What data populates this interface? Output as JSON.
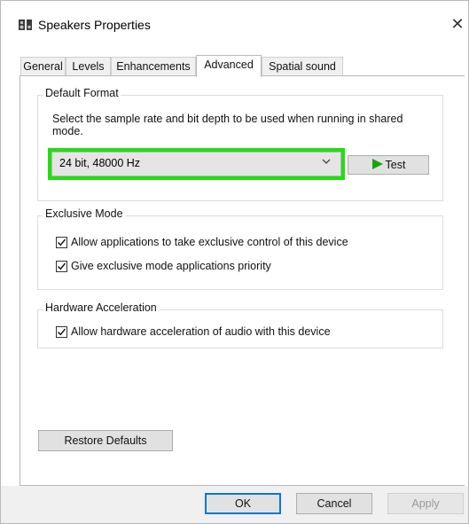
{
  "window": {
    "title": "Speakers Properties",
    "close_glyph": "✕"
  },
  "tabs": [
    {
      "label": "General",
      "active": false
    },
    {
      "label": "Levels",
      "active": false
    },
    {
      "label": "Enhancements",
      "active": false
    },
    {
      "label": "Advanced",
      "active": true
    },
    {
      "label": "Spatial sound",
      "active": false
    }
  ],
  "default_format": {
    "title": "Default Format",
    "description": "Select the sample rate and bit depth to be used when running in shared mode.",
    "selected_value": "24 bit, 48000 Hz",
    "test_label": "Test",
    "highlight_color": "#1ee00f"
  },
  "exclusive_mode": {
    "title": "Exclusive Mode",
    "options": [
      {
        "label": "Allow applications to take exclusive control of this device",
        "checked": true
      },
      {
        "label": "Give exclusive mode applications priority",
        "checked": true
      }
    ]
  },
  "hardware_acceleration": {
    "title": "Hardware Acceleration",
    "options": [
      {
        "label": "Allow hardware acceleration of audio with this device",
        "checked": true
      }
    ]
  },
  "restore_defaults_label": "Restore Defaults",
  "footer": {
    "ok_label": "OK",
    "cancel_label": "Cancel",
    "apply_label": "Apply"
  },
  "colors": {
    "accent": "#0078d7",
    "play_icon": "#19a30e"
  }
}
